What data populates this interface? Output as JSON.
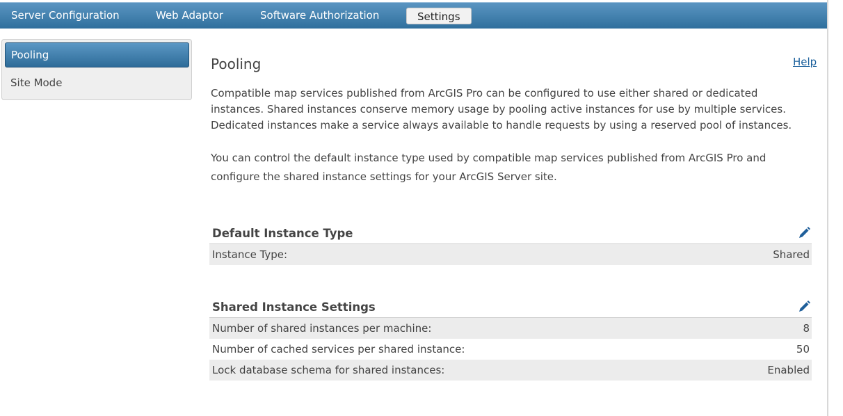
{
  "topnav": {
    "tabs": [
      {
        "label": "Server Configuration"
      },
      {
        "label": "Web Adaptor"
      },
      {
        "label": "Software Authorization"
      },
      {
        "label": "Settings"
      }
    ],
    "active_index": 3
  },
  "sidebar": {
    "items": [
      {
        "label": "Pooling",
        "active": true
      },
      {
        "label": "Site Mode",
        "active": false
      }
    ]
  },
  "main": {
    "title": "Pooling",
    "help_label": "Help",
    "paragraph1": "Compatible map services published from ArcGIS Pro can be configured to use either shared or dedicated instances. Shared instances conserve memory usage by pooling active instances for use by multiple services. Dedicated instances make a service always available to handle requests by using a reserved pool of instances.",
    "paragraph2": "You can control the default instance type used by compatible map services published from ArcGIS Pro and configure the shared instance settings for your ArcGIS Server site.",
    "sections": [
      {
        "title": "Default Instance Type",
        "edit_icon": "pencil-icon",
        "rows": [
          {
            "label": "Instance Type:",
            "value": "Shared"
          }
        ]
      },
      {
        "title": "Shared Instance Settings",
        "edit_icon": "pencil-icon",
        "rows": [
          {
            "label": "Number of shared instances per machine:",
            "value": "8"
          },
          {
            "label": "Number of cached services per shared instance:",
            "value": "50"
          },
          {
            "label": "Lock database schema for shared instances:",
            "value": "Enabled"
          }
        ]
      }
    ]
  },
  "colors": {
    "nav_top": "#5a95c2",
    "nav_bottom": "#2f6f9d",
    "link": "#1a5f9c",
    "row_shade": "#ececec",
    "text": "#444444"
  }
}
